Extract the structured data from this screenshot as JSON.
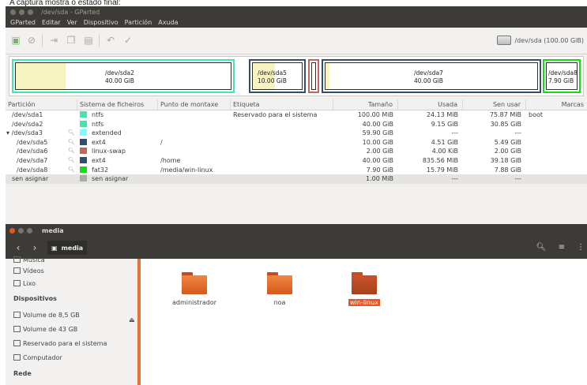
{
  "caption": {
    "text": "A captura mostra o estado final:"
  },
  "gparted": {
    "title": "/dev/sda - GParted",
    "menu": [
      "GParted",
      "Editar",
      "Ver",
      "Dispositivo",
      "Partición",
      "Axuda"
    ],
    "device": "/dev/sda  (100.00 GiB)",
    "map": [
      {
        "name": "/dev/sda2",
        "size": "40.00 GiB",
        "fs": "ntfs",
        "used_fraction": 0.23
      },
      {
        "name": "/dev/sda5",
        "size": "10.00 GiB",
        "fs": "ext4",
        "used_fraction": 0.45
      },
      {
        "name": "",
        "size": "",
        "fs": "linux-swap",
        "used_fraction": 0.0
      },
      {
        "name": "/dev/sda7",
        "size": "40.00 GiB",
        "fs": "ext4",
        "used_fraction": 0.02
      },
      {
        "name": "/dev/sda8",
        "size": "7.90 GiB",
        "fs": "fat32",
        "used_fraction": 0.0
      }
    ],
    "columns": [
      "Partición",
      "Sistema de ficheiros",
      "Punto de montaxe",
      "Etiqueta",
      "Tamaño",
      "Usada",
      "Sen usar",
      "Marcas"
    ],
    "rows": [
      {
        "partition": "/dev/sda1",
        "fs": "ntfs",
        "fs_color": "#42e5ac",
        "mount": "",
        "label": "Reservado para el sistema",
        "size": "100.00 MiB",
        "used": "24.13 MiB",
        "unused": "75.87 MiB",
        "flags": "boot",
        "lock": false,
        "expander": false
      },
      {
        "partition": "/dev/sda2",
        "fs": "ntfs",
        "fs_color": "#42e5ac",
        "mount": "",
        "label": "",
        "size": "40.00 GiB",
        "used": "9.15 GiB",
        "unused": "30.85 GiB",
        "flags": "",
        "lock": false,
        "expander": false
      },
      {
        "partition": "/dev/sda3",
        "fs": "extended",
        "fs_color": "#7dfcfe",
        "mount": "",
        "label": "",
        "size": "59.90 GiB",
        "used": "---",
        "unused": "---",
        "flags": "",
        "lock": true,
        "expander": true
      },
      {
        "partition": "/dev/sda5",
        "fs": "ext4",
        "fs_color": "#314e6c",
        "mount": "/",
        "label": "",
        "size": "10.00 GiB",
        "used": "4.51 GiB",
        "unused": "5.49 GiB",
        "flags": "",
        "lock": true,
        "expander": false
      },
      {
        "partition": "/dev/sda6",
        "fs": "linux-swap",
        "fs_color": "#c1665a",
        "mount": "",
        "label": "",
        "size": "2.00 GiB",
        "used": "4.00 KiB",
        "unused": "2.00 GiB",
        "flags": "",
        "lock": true,
        "expander": false
      },
      {
        "partition": "/dev/sda7",
        "fs": "ext4",
        "fs_color": "#314e6c",
        "mount": "/home",
        "label": "",
        "size": "40.00 GiB",
        "used": "835.56 MiB",
        "unused": "39.18 GiB",
        "flags": "",
        "lock": true,
        "expander": false
      },
      {
        "partition": "/dev/sda8",
        "fs": "fat32",
        "fs_color": "#18d918",
        "mount": "/media/win-linux",
        "label": "",
        "size": "7.90 GiB",
        "used": "15.79 MiB",
        "unused": "7.88 GiB",
        "flags": "",
        "lock": true,
        "expander": false
      },
      {
        "partition": "sen asignar",
        "fs": "sen asignar",
        "fs_color": "#a9a9a9",
        "mount": "",
        "label": "",
        "size": "1.00 MiB",
        "used": "---",
        "unused": "---",
        "flags": "",
        "lock": false,
        "expander": false,
        "unallocated": true
      }
    ]
  },
  "nautilus": {
    "title": "media",
    "path": "media",
    "sidebar": {
      "items_top": [
        "Música",
        "Vídeos",
        "Lixo"
      ],
      "devices_heading": "Dispositivos",
      "devices": [
        "Volume de 8,5 GB",
        "Volume de 43 GB",
        "Reservado para el sistema",
        "Computador"
      ],
      "network_heading": "Rede"
    },
    "folders": [
      {
        "name": "administrador",
        "selected": false
      },
      {
        "name": "noa",
        "selected": false
      },
      {
        "name": "win-linux",
        "selected": true
      }
    ]
  }
}
